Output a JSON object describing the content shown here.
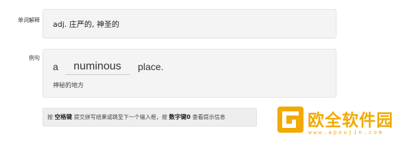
{
  "labels": {
    "definition": "单词解释",
    "example": "例句"
  },
  "definition": {
    "text": "adj. 庄严的, 神圣的"
  },
  "example": {
    "before_word": "a",
    "input_value": "numinous",
    "after_word": "place.",
    "translation": "神秘的地方"
  },
  "hint": {
    "part1": "按 ",
    "key1": "空格键",
    "part2": " 提交拼写结果或跳至下一个输入框，按 ",
    "key2": "数字键0",
    "part3": " 查看提示信息"
  },
  "watermark": {
    "name": "欧全软件园",
    "url": "www.apoujin.com",
    "color": "#f2a900"
  }
}
